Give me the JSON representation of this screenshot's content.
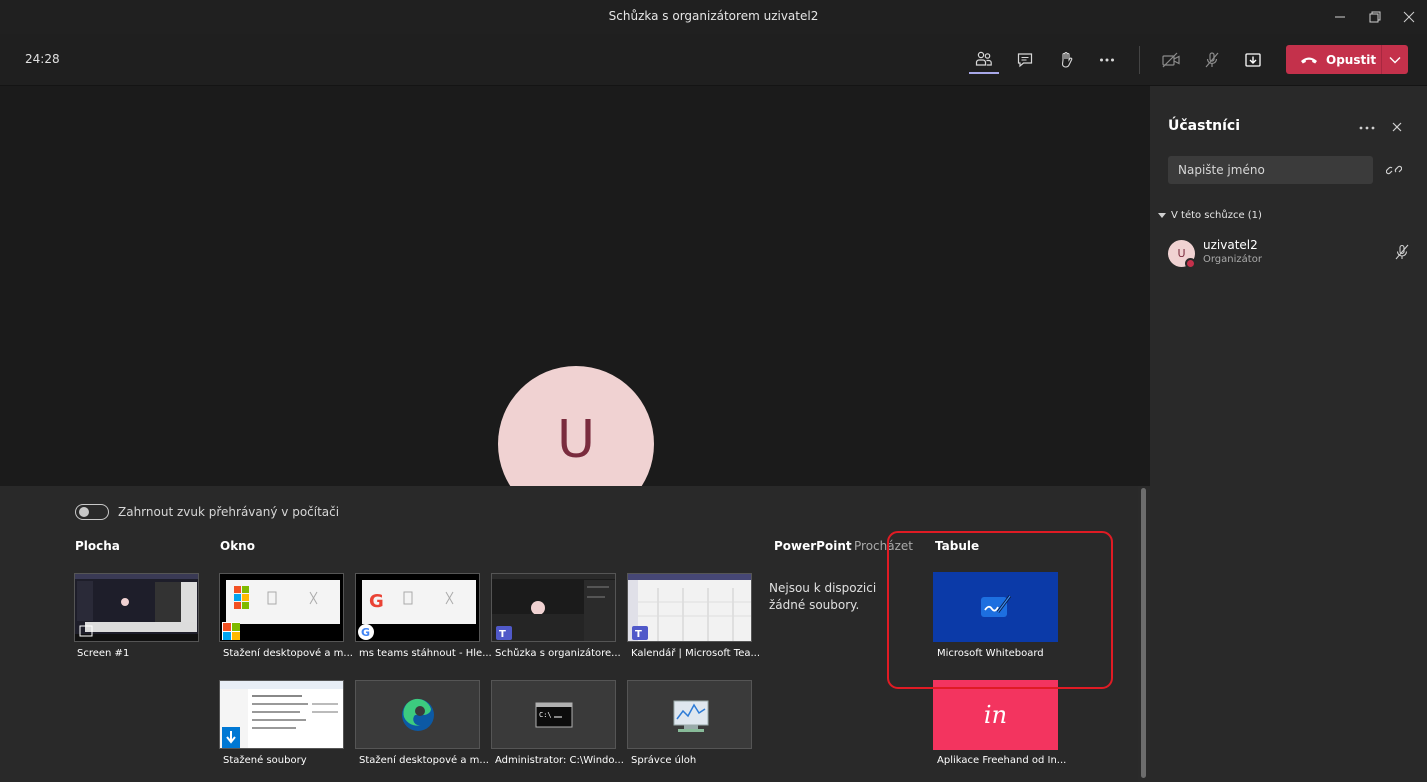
{
  "window": {
    "title": "Schůzka s organizátorem uzivatel2"
  },
  "toolbar": {
    "timer": "24:28",
    "leave_label": "Opustit"
  },
  "stage": {
    "avatar_initial": "U"
  },
  "share": {
    "include_audio_label": "Zahrnout zvuk přehrávaný v počítači",
    "include_audio_on": false,
    "sections": {
      "desktop": "Plocha",
      "window": "Okno",
      "powerpoint": "PowerPoint",
      "browse": "Procházet",
      "whiteboard": "Tabule"
    },
    "desktop_items": [
      {
        "label": "Screen #1"
      }
    ],
    "window_items": [
      {
        "label": "Stažení desktopové a m..."
      },
      {
        "label": "ms teams stáhnout - Hle..."
      },
      {
        "label": "Schůzka s organizátore..."
      },
      {
        "label": "Kalendář | Microsoft Tea..."
      },
      {
        "label": "Stažené soubory"
      },
      {
        "label": "Stažení desktopové a m..."
      },
      {
        "label": "Administrator: C:\\Windo..."
      },
      {
        "label": "Správce úloh"
      }
    ],
    "powerpoint_empty": "Nejsou k dispozici žádné soubory.",
    "whiteboard_items": [
      {
        "label": "Microsoft Whiteboard"
      },
      {
        "label": "Aplikace Freehand od In...",
        "logo_text": "in"
      }
    ]
  },
  "participants": {
    "title": "Účastníci",
    "search_placeholder": "Napište jméno",
    "group_label": "V této schůzce (1)",
    "members": [
      {
        "initial": "U",
        "name": "uzivatel2",
        "role": "Organizátor"
      }
    ]
  },
  "colors": {
    "accent_leave": "#c4314b",
    "highlight": "#e01b24",
    "whiteboard": "#0b3aa8",
    "invision": "#f3345f",
    "avatar_bg": "#f0d2d2"
  }
}
